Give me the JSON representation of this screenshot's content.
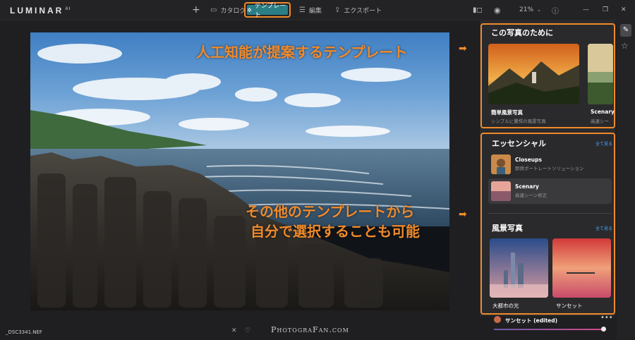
{
  "app": {
    "logo": "LUMINAR",
    "logo_sup": "AI"
  },
  "toolbar": {
    "add": "+",
    "catalog": "カタログ",
    "templates": "テンプレート",
    "edit": "編集",
    "export": "エクスポート",
    "zoom": "21%"
  },
  "callouts": {
    "ai_templates": "人工知能が提案するテンプレート",
    "other_line1": "その他のテンプレートから",
    "other_line2": "自分で選択することも可能"
  },
  "panel": {
    "for_photo_title": "この写真のために",
    "featured": [
      {
        "name": "簡単風景写真",
        "desc": "シンプルに驚愕の風景写真"
      },
      {
        "name": "Scenary",
        "desc": "高速シー"
      }
    ],
    "essential_title": "エッセンシャル",
    "see_all": "全て見る",
    "essential_items": [
      {
        "name": "Closeups",
        "desc": "即席ポートレートソリューション"
      },
      {
        "name": "Scenary",
        "desc": "高速シーン修正"
      }
    ],
    "landscape_title": "風景写真",
    "landscape_items": [
      {
        "name": "大都市の光"
      },
      {
        "name": "サンセット"
      }
    ],
    "applied": "サンセット (edited)"
  },
  "footer": {
    "filename": "_DSC3341.NEF",
    "watermark": "PhotograFan.com"
  },
  "colors": {
    "accent": "#f08a2b",
    "active_tab": "#2a7f86",
    "link": "#4aa5ff"
  }
}
